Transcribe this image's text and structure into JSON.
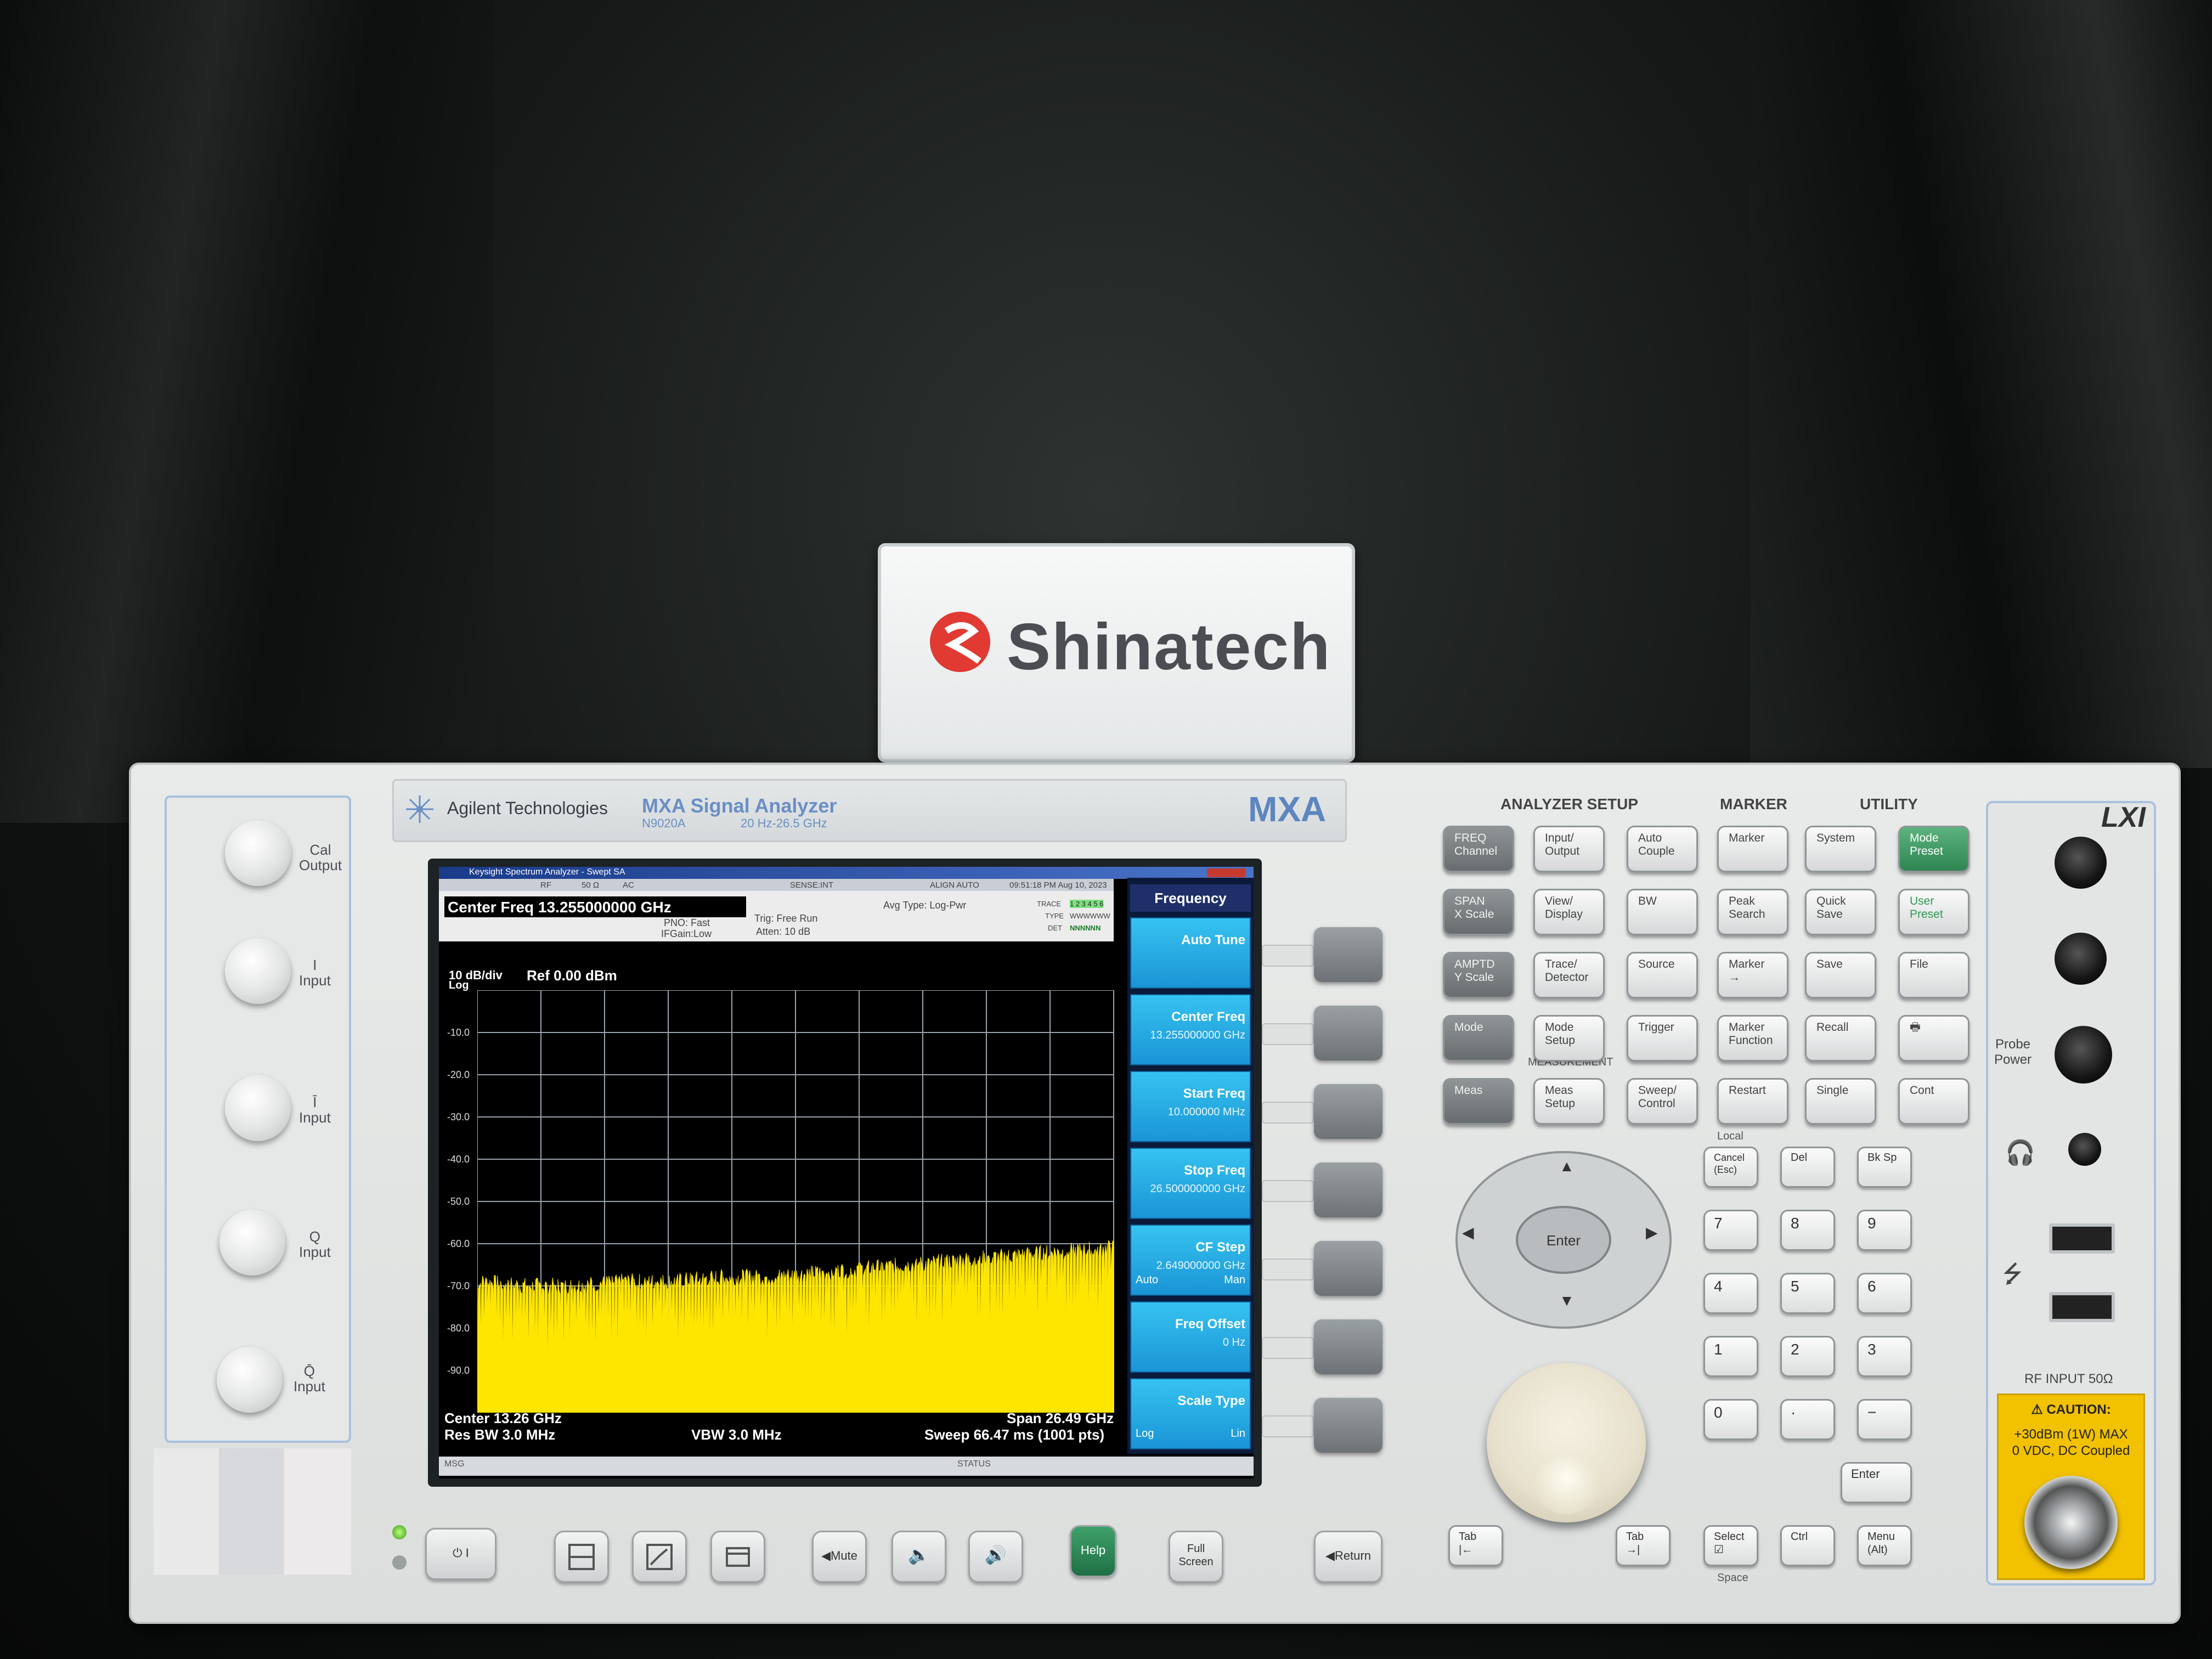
{
  "sign": {
    "brand": "Shinatech"
  },
  "instrument": {
    "maker": "Agilent Technologies",
    "product": "MXA Signal Analyzer",
    "model": "N9020A",
    "range": "20 Hz-26.5 GHz",
    "badge": "MXA"
  },
  "left_ports": [
    {
      "label": "Cal\nOutput"
    },
    {
      "label": "I\nInput"
    },
    {
      "label": "Ī\nInput"
    },
    {
      "label": "Q\nInput"
    },
    {
      "label": "Q̄\nInput"
    }
  ],
  "screen": {
    "window_title": "Keysight Spectrum Analyzer - Swept SA",
    "info_bar": {
      "rf": "RF",
      "impedance": "50 Ω",
      "coupling": "AC",
      "sense": "SENSE:INT",
      "align": "ALIGN AUTO",
      "datetime": "09:51:18 PM Aug 10, 2023"
    },
    "center_freq_header": "Center Freq 13.255000000 GHz",
    "pno": "PNO: Fast",
    "ifgain": "IFGain:Low",
    "trig": "Trig: Free Run",
    "atten": "Atten: 10 dB",
    "avg_type": "Avg Type: Log-Pwr",
    "trace_table": {
      "trace_label": "TRACE",
      "type_label": "TYPE",
      "det_label": "DET",
      "traces": "1 2 3 4 5 6",
      "type": "WWWWWW",
      "det": "NNNNNN"
    },
    "scale": "10 dB/div",
    "scale_type": "Log",
    "ref": "Ref 0.00 dBm",
    "y_ticks": [
      "-10.0",
      "-20.0",
      "-30.0",
      "-40.0",
      "-50.0",
      "-60.0",
      "-70.0",
      "-80.0",
      "-90.0"
    ],
    "center": "Center 13.26 GHz",
    "res_bw": "Res BW 3.0 MHz",
    "vbw": "VBW 3.0 MHz",
    "span": "Span 26.49 GHz",
    "sweep": "Sweep  66.47 ms (1001 pts)",
    "status_left": "MSG",
    "status_center": "STATUS"
  },
  "chart_data": {
    "type": "area",
    "title": "",
    "xlabel": "",
    "ylabel": "",
    "ylim": [
      -100,
      0
    ],
    "x_range_ghz": [
      0.01,
      26.5
    ],
    "series": [
      {
        "x": [
          0.01,
          2,
          4,
          6,
          8,
          10,
          12,
          14,
          16,
          18,
          20,
          22,
          24,
          26.5
        ],
        "values": [
          -69,
          -70,
          -70,
          -69,
          -69,
          -68,
          -68,
          -67,
          -66,
          -65,
          -64,
          -63,
          -62,
          -61
        ]
      }
    ],
    "trace_color": "#ffe600",
    "grid": true
  },
  "softkeys": {
    "header": "Frequency",
    "items": [
      {
        "title": "Auto Tune",
        "value": ""
      },
      {
        "title": "Center Freq",
        "value": "13.255000000 GHz"
      },
      {
        "title": "Start Freq",
        "value": "10.000000 MHz"
      },
      {
        "title": "Stop Freq",
        "value": "26.500000000 GHz"
      },
      {
        "title": "CF Step",
        "value": "2.649000000 GHz",
        "left": "Auto",
        "right": "Man"
      },
      {
        "title": "Freq Offset",
        "value": "0 Hz"
      },
      {
        "title": "Scale Type",
        "value": "",
        "left": "Log",
        "right": "Lin"
      }
    ]
  },
  "bottom_buttons": {
    "power": "⏻ I",
    "mute": "◀Mute",
    "help": "Help",
    "full_screen": "Full\nScreen",
    "return": "◀Return"
  },
  "panel": {
    "sections": {
      "setup": "ANALYZER SETUP",
      "marker": "MARKER",
      "utility": "UTILITY",
      "measurement": "MEASUREMENT",
      "local": "Local",
      "space": "Space"
    },
    "keys": [
      {
        "id": "freq",
        "label": "FREQ\nChannel",
        "style": "dark"
      },
      {
        "id": "input",
        "label": "Input/\nOutput",
        "style": ""
      },
      {
        "id": "autocouple",
        "label": "Auto\nCouple",
        "style": ""
      },
      {
        "id": "marker",
        "label": "Marker",
        "style": ""
      },
      {
        "id": "system",
        "label": "System",
        "style": ""
      },
      {
        "id": "modepreset",
        "label": "Mode\nPreset",
        "style": "green"
      },
      {
        "id": "span",
        "label": "SPAN\nX Scale",
        "style": "dark"
      },
      {
        "id": "view",
        "label": "View/\nDisplay",
        "style": ""
      },
      {
        "id": "bw",
        "label": "BW",
        "style": ""
      },
      {
        "id": "peak",
        "label": "Peak\nSearch",
        "style": ""
      },
      {
        "id": "quicksave",
        "label": "Quick\nSave",
        "style": ""
      },
      {
        "id": "userpreset",
        "label": "User\nPreset",
        "style": "greentext"
      },
      {
        "id": "amptd",
        "label": "AMPTD\nY Scale",
        "style": "dark"
      },
      {
        "id": "trace",
        "label": "Trace/\nDetector",
        "style": ""
      },
      {
        "id": "source",
        "label": "Source",
        "style": ""
      },
      {
        "id": "markerarrow",
        "label": "Marker\n→",
        "style": ""
      },
      {
        "id": "save",
        "label": "Save",
        "style": ""
      },
      {
        "id": "file",
        "label": "File",
        "style": ""
      },
      {
        "id": "mode",
        "label": "Mode",
        "style": "dark"
      },
      {
        "id": "modesetup",
        "label": "Mode\nSetup",
        "style": ""
      },
      {
        "id": "trigger",
        "label": "Trigger",
        "style": ""
      },
      {
        "id": "markerfunc",
        "label": "Marker\nFunction",
        "style": ""
      },
      {
        "id": "recall",
        "label": "Recall",
        "style": ""
      },
      {
        "id": "print",
        "label": "🖶",
        "style": ""
      },
      {
        "id": "meas",
        "label": "Meas",
        "style": "dark"
      },
      {
        "id": "meassetup",
        "label": "Meas\nSetup",
        "style": ""
      },
      {
        "id": "sweep",
        "label": "Sweep/\nControl",
        "style": ""
      },
      {
        "id": "restart",
        "label": "Restart",
        "style": ""
      },
      {
        "id": "single",
        "label": "Single",
        "style": ""
      },
      {
        "id": "cont",
        "label": "Cont",
        "style": ""
      }
    ],
    "edit_keys": {
      "cancel": "Cancel\n(Esc)",
      "del": "Del",
      "bksp": "Bk Sp"
    },
    "numpad": [
      "7",
      "8",
      "9",
      "4",
      "5",
      "6",
      "1",
      "2",
      "3",
      "0",
      "·",
      "−"
    ],
    "enter": "Enter",
    "dpad_enter": "Enter",
    "bottom_keys": {
      "tab_left": "Tab\n|←",
      "tab_right": "Tab\n→|",
      "select": "Select\n☑",
      "ctrl": "Ctrl",
      "menu": "Menu\n(Alt)"
    }
  },
  "connectors": {
    "lxi": "LXI",
    "probe_power": "Probe\nPower",
    "rf_input": "RF INPUT 50Ω",
    "caution_title": "⚠ CAUTION:",
    "caution_line1": "+30dBm (1W) MAX",
    "caution_line2": "0 VDC, DC Coupled"
  }
}
